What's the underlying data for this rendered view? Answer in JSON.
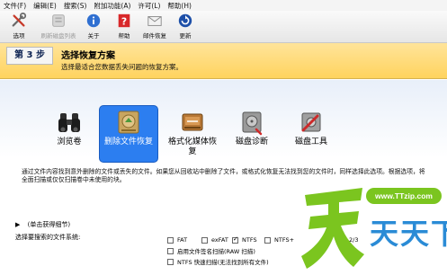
{
  "menu": [
    "文件(F)",
    "编辑(E)",
    "搜索(S)",
    "附加功能(A)",
    "许可(L)",
    "帮助(H)"
  ],
  "toolbar": {
    "options": "选项",
    "drive_list": "刷新磁盘列表",
    "about": "关于",
    "help": "帮助",
    "mail": "邮件恢复",
    "update": "更新"
  },
  "step": {
    "label": "第 3 步",
    "title": "选择恢复方案",
    "subtitle": "选择最适合您数据丢失问题的恢复方案。"
  },
  "options": [
    {
      "label": "浏览卷",
      "icon": "binoculars-icon",
      "selected": false
    },
    {
      "label": "删除文件恢复",
      "icon": "recycle-drive-icon",
      "selected": true
    },
    {
      "label": "格式化媒体恢复",
      "icon": "format-drive-icon",
      "selected": false
    },
    {
      "label": "磁盘诊断",
      "icon": "disk-diagnostic-icon",
      "selected": false
    },
    {
      "label": "磁盘工具",
      "icon": "disk-tools-icon",
      "selected": false
    }
  ],
  "description": "通过文件内容找到意外删除的文件或丢失的文件。如果您从回收站中删除了文件，或格式化恢复无法找到您的文件时，同样选择此选项。根据选项，将全面扫描或仅仅扫描卷中未使用的块。",
  "more_details": "(单击获得细节)",
  "fs_label": "选择要搜索的文件系统:",
  "fs": {
    "fat": "FAT",
    "exfat": "exFAT",
    "ntfs": "NTFS",
    "ntfs_plus": "NTFS+",
    "extra": "2/3",
    "sig_scan": "启用文件签名扫描(RAW 扫描)",
    "ntfs_quick": "NTFS 快速扫描(无法找到所有文件)"
  },
  "watermark": {
    "url": "www.TTzip.com",
    "name": "天天下载"
  },
  "colors": {
    "step_bar": "#ffd35e",
    "selected_option": "#2c7ef0",
    "watermark_green": "#7bc51f",
    "watermark_blue": "#2a8bd6"
  }
}
